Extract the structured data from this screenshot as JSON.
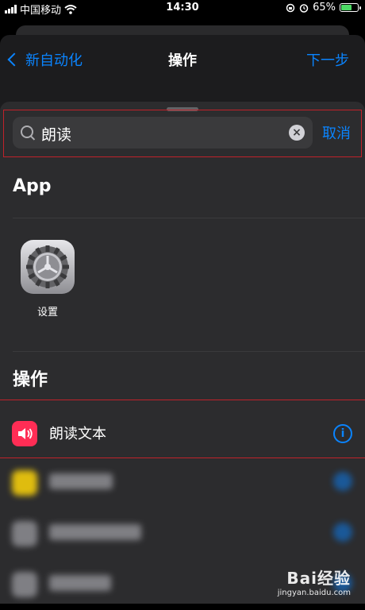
{
  "status_bar": {
    "carrier": "中国移动",
    "time": "14:30",
    "battery": "65%"
  },
  "nav": {
    "back_label": "新自动化",
    "title": "操作",
    "next_label": "下一步"
  },
  "search": {
    "value": "朗读",
    "cancel_label": "取消"
  },
  "sections": {
    "app_header": "App",
    "actions_header": "操作"
  },
  "apps": [
    {
      "label": "设置",
      "icon": "settings-gear-icon"
    }
  ],
  "actions": [
    {
      "label": "朗读文本",
      "icon": "speaker-icon",
      "color": "#ff2d55"
    }
  ],
  "watermark": {
    "brand": "Bai经验",
    "url": "jingyan.baidu.com"
  },
  "colors": {
    "accent": "#0a84ff",
    "highlight_border": "#c0222a",
    "speak_icon": "#ff2d55"
  }
}
